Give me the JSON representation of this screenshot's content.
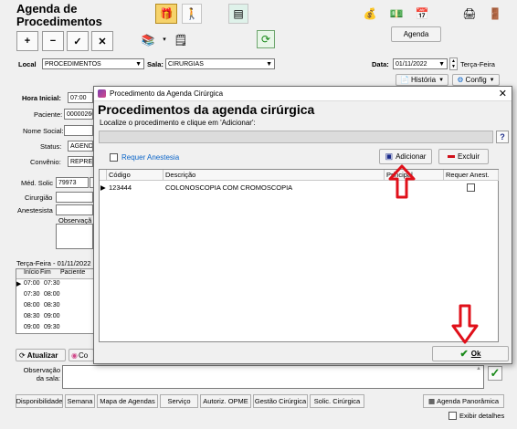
{
  "app": {
    "title_line1": "Agenda de",
    "title_line2": "Procedimentos",
    "agenda_button": "Agenda",
    "local_label": "Local",
    "local_value": "PROCEDIMENTOS",
    "sala_label": "Sala:",
    "sala_value": "CIRURGIAS",
    "data_label": "Data:",
    "data_value": "01/11/2022",
    "weekday": "Terça-Feira",
    "historia_label": "História",
    "config_label": "Config"
  },
  "form": {
    "hora_inicial_label": "Hora Inicial:",
    "hora_inicial_value": "07:00",
    "paciente_label": "Paciente:",
    "paciente_value": "00000260",
    "nome_social_label": "Nome Social:",
    "status_label": "Status:",
    "status_value": "AGENDA",
    "convenio_label": "Convênio:",
    "convenio_value": "REPRES",
    "med_solic_label": "Méd. Solic",
    "med_solic_value": "79973",
    "cirurgiao_label": "Cirurgião",
    "anestesista_label": "Anestesista",
    "observacao_label": "Observaçã"
  },
  "schedule": {
    "date_header": "Terça-Feira - 01/11/2022",
    "columns": [
      "Início",
      "Fim",
      "Paciente"
    ],
    "rows": [
      {
        "inicio": "07:00",
        "fim": "07:30"
      },
      {
        "inicio": "07:30",
        "fim": "08:00"
      },
      {
        "inicio": "08:00",
        "fim": "08:30"
      },
      {
        "inicio": "08:30",
        "fim": "09:00"
      },
      {
        "inicio": "09:00",
        "fim": "09:30"
      }
    ],
    "atualizar_label": "Atualizar",
    "cor_label": "Co"
  },
  "footer": {
    "observacao_sala_label1": "Observação",
    "observacao_sala_label2": "da sala:",
    "buttons": [
      "Disponibilidade",
      "Semana",
      "Mapa de Agendas",
      "Serviço",
      "Autoriz. OPME",
      "Gestão Cirúrgica",
      "Solic. Cirúrgica"
    ],
    "panoramica_label": "Agenda Panorâmica",
    "exibir_detalhes_label": "Exibir detalhes"
  },
  "dialog": {
    "window_title": "Procedimento da Agenda Cirúrgica",
    "heading": "Procedimentos da agenda cirúrgica",
    "instruction": "Localize o procedimento e clique em 'Adicionar':",
    "help_label": "?",
    "requer_anestesia_label": "Requer Anestesia",
    "adicionar_label": "Adicionar",
    "excluir_label": "Excluir",
    "columns": [
      "Código",
      "Descrição",
      "Principal",
      "Requer Anest."
    ],
    "rows": [
      {
        "codigo": "123444",
        "descricao": "COLONOSCOPIA COM CROMOSCOPIA",
        "requer_anest": false
      }
    ],
    "ok_label": "Ok"
  },
  "colors": {
    "arrow_red": "#e0101a",
    "accent_blue": "#0a64c8",
    "ok_green": "#1a8a1a"
  }
}
